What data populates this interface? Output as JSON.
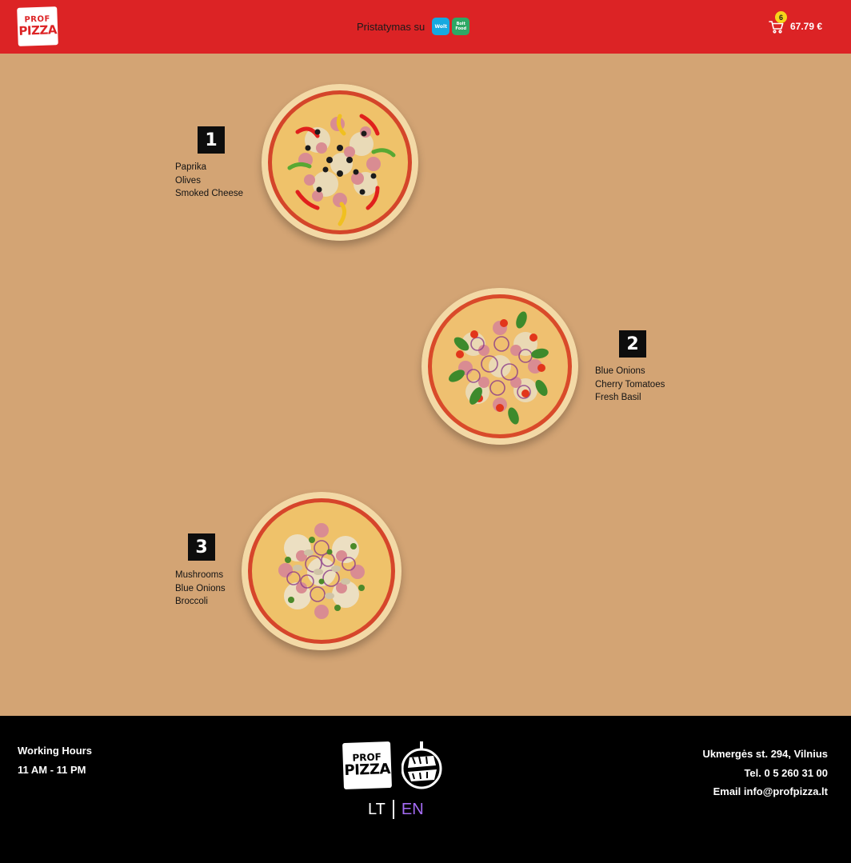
{
  "header": {
    "logo": {
      "line1": "PROF",
      "line2": "PIZZA"
    },
    "delivery_text": "Pristatymas su",
    "delivery_partners": [
      {
        "name": "Wolt",
        "color": "#16a9e0"
      },
      {
        "name": "Bolt Food",
        "color": "#2ea865"
      }
    ],
    "cart": {
      "icon": "cart-icon",
      "count": "6",
      "total": "67.79 €"
    }
  },
  "pizzas": [
    {
      "number": "1",
      "ingredients": [
        "Paprika",
        "Olives",
        "Smoked Cheese"
      ]
    },
    {
      "number": "2",
      "ingredients": [
        "Blue Onions",
        "Cherry Tomatoes",
        "Fresh Basil"
      ]
    },
    {
      "number": "3",
      "ingredients": [
        "Mushrooms",
        "Blue Onions",
        "Broccoli"
      ]
    }
  ],
  "footer": {
    "working_hours_title": "Working Hours",
    "working_hours": "11 AM - 11 PM",
    "logos": [
      {
        "line1": "PROF",
        "line2": "PIZZA"
      },
      {
        "name": "KEBAB PRIME"
      }
    ],
    "languages": [
      "LT",
      "EN"
    ],
    "active_language": "EN",
    "address": "Ukmergės st. 294, Vilnius",
    "phone": "Tel. 0 5 260 31 00",
    "email": "Email info@profpizza.lt"
  },
  "colors": {
    "header_bg": "#dc2325",
    "page_bg": "#d3a474",
    "footer_bg": "#000000",
    "cart_badge": "#f6d51a",
    "active_language": "#a56cf5"
  }
}
